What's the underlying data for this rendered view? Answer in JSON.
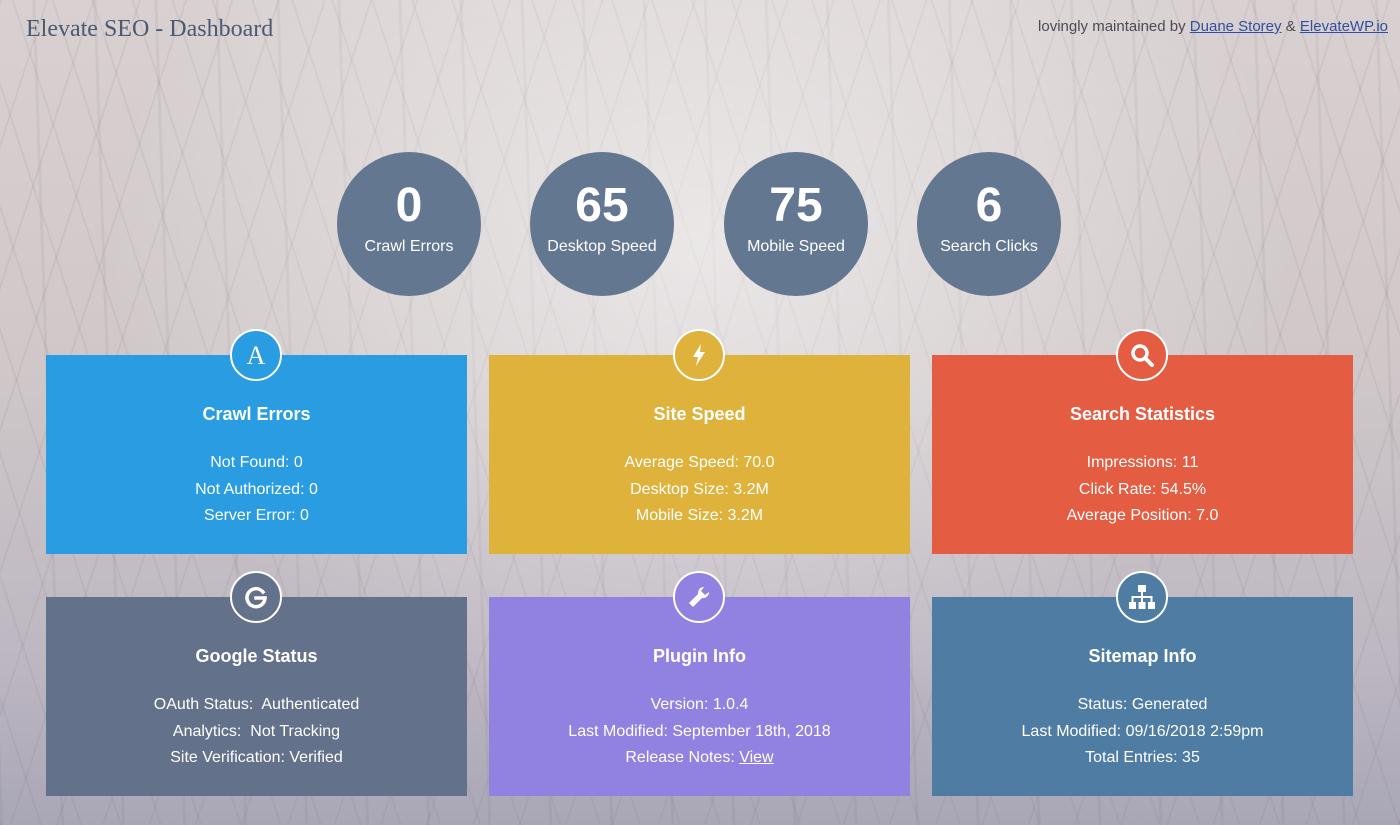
{
  "header": {
    "title": "Elevate SEO - Dashboard",
    "credit_prefix": "lovingly maintained by",
    "credit_author": "Duane Storey",
    "credit_separator": "&",
    "credit_site": "ElevateWP.io"
  },
  "stats": [
    {
      "value": "0",
      "label": "Crawl Errors"
    },
    {
      "value": "65",
      "label": "Desktop Speed"
    },
    {
      "value": "75",
      "label": "Mobile Speed"
    },
    {
      "value": "6",
      "label": "Search Clicks"
    }
  ],
  "cards": {
    "crawl_errors": {
      "title": "Crawl Errors",
      "icon": "letter-a-icon",
      "color": "#299ce2",
      "lines": [
        "Not Found: 0",
        "Not Authorized: 0",
        "Server Error: 0"
      ]
    },
    "site_speed": {
      "title": "Site Speed",
      "icon": "lightning-icon",
      "color": "#dfb23c",
      "lines": [
        "Average Speed: 70.0",
        "Desktop Size: 3.2M",
        "Mobile Size: 3.2M"
      ]
    },
    "search_statistics": {
      "title": "Search Statistics",
      "icon": "magnifier-icon",
      "color": "#e45d43",
      "lines": [
        "Impressions: 11",
        "Click Rate: 54.5%",
        "Average Position: 7.0"
      ]
    },
    "google_status": {
      "title": "Google Status",
      "icon": "google-g-icon",
      "color": "#63728a",
      "lines": [
        "OAuth Status:  Authenticated",
        "Analytics:  Not Tracking",
        "Site Verification: Verified"
      ]
    },
    "plugin_info": {
      "title": "Plugin Info",
      "icon": "wrench-icon",
      "color": "#9182e1",
      "lines": [
        "Version: 1.0.4",
        "Last Modified: September 18th, 2018"
      ],
      "release_label": "Release Notes:",
      "release_link": "View"
    },
    "sitemap_info": {
      "title": "Sitemap Info",
      "icon": "sitemap-icon",
      "color": "#4e7ca3",
      "lines": [
        "Status: Generated",
        "Last Modified: 09/16/2018 2:59pm",
        "Total Entries: 35"
      ]
    }
  }
}
